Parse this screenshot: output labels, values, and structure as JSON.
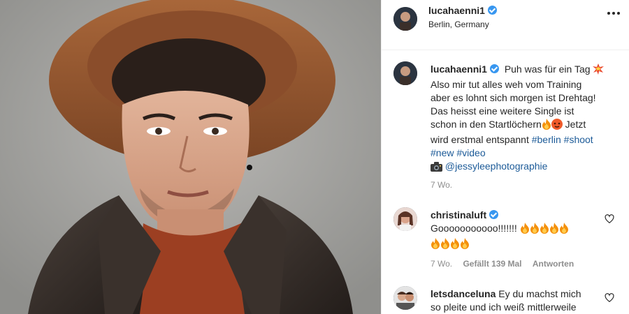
{
  "post": {
    "username": "lucahaenni1",
    "location": "Berlin, Germany"
  },
  "caption": {
    "username": "lucahaenni1",
    "line1": "Puh was für ein Tag",
    "line2": "Also mir tut alles weh vom Training",
    "line3": "aber es lohnt sich morgen ist Drehtag!",
    "line4": "Das heisst eine weitere Single ist",
    "line5a": "schon in den Startlöchern",
    "line5b": "Jetzt",
    "line6": "wird erstmal entspannt",
    "tags": [
      "#berlin",
      "#shoot",
      "#new",
      "#video"
    ],
    "mention": "@jessyleephotographie",
    "time": "7 Wo."
  },
  "comments": [
    {
      "username": "christinaluft",
      "text": "Gooooooooooo!!!!!!!",
      "time": "7 Wo.",
      "likes": "Gefällt 139 Mal",
      "reply": "Antworten"
    },
    {
      "username": "letsdanceluna",
      "text1": "Ey du machst mich",
      "text2": "so pleite und ich weiß mittlerweile"
    }
  ],
  "icons": {
    "verified": "verified-badge-icon",
    "more": "more-options-icon",
    "heart": "heart-outline-icon",
    "collision": "collision-emoji-icon",
    "fire": "fire-emoji-icon",
    "sweat": "hot-face-emoji-icon",
    "camera": "camera-emoji-icon"
  },
  "colors": {
    "verified": "#3897f0",
    "link": "#1d5b98",
    "muted": "#8e8e8e",
    "text": "#262626"
  }
}
